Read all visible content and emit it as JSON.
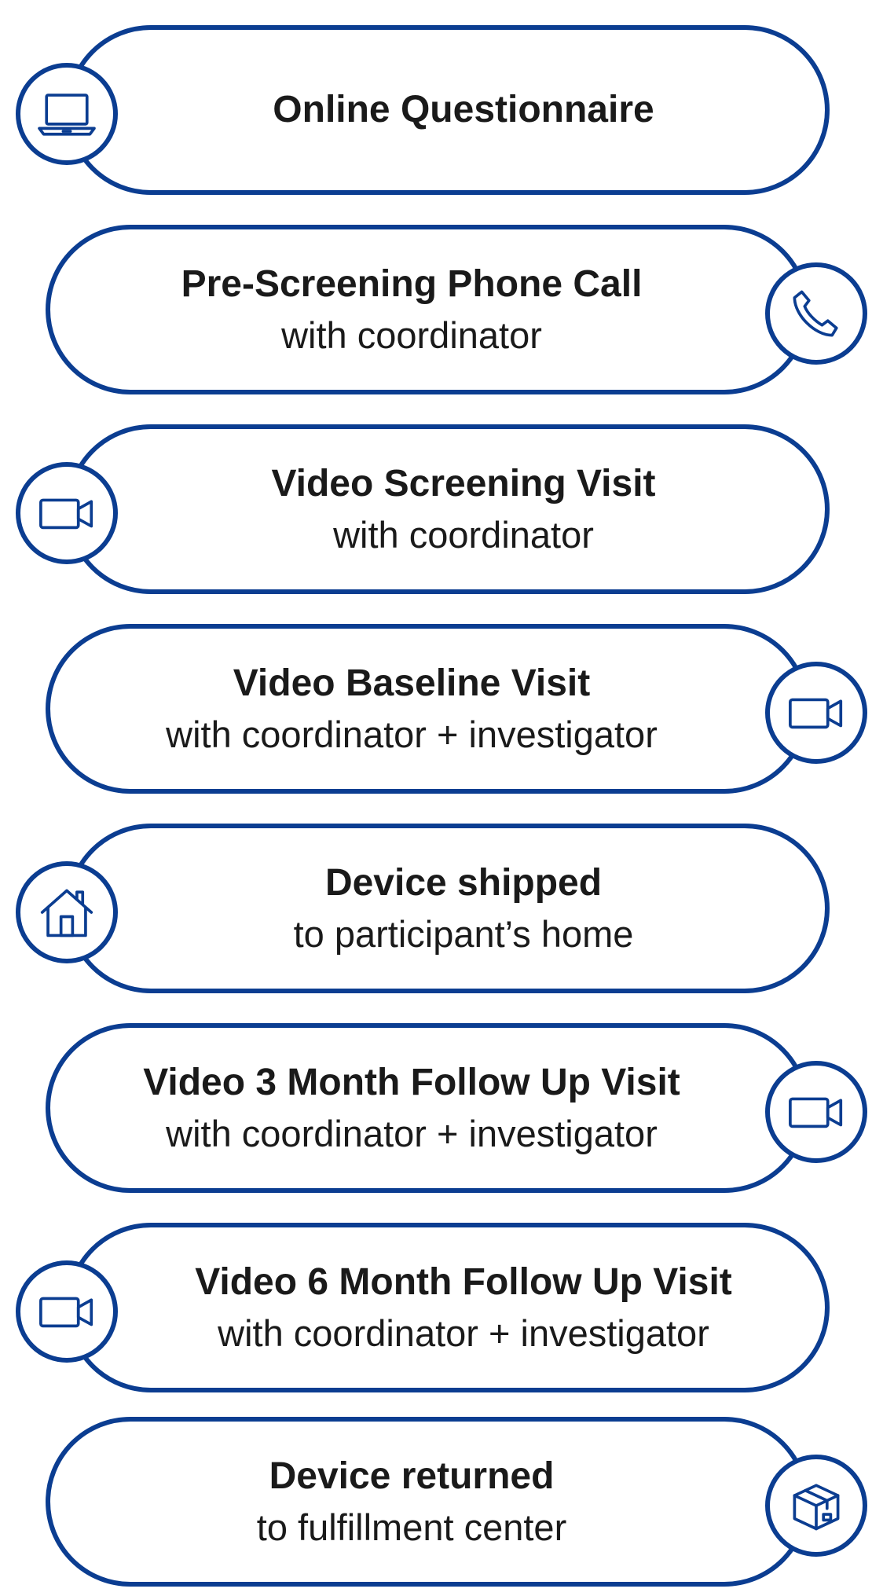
{
  "steps": [
    {
      "title": "Online Questionnaire",
      "subtitle": "",
      "icon": "laptop-icon",
      "side": "left"
    },
    {
      "title": "Pre-Screening Phone Call",
      "subtitle": "with coordinator",
      "icon": "phone-icon",
      "side": "right"
    },
    {
      "title": "Video Screening Visit",
      "subtitle": "with coordinator",
      "icon": "video-camera-icon",
      "side": "left"
    },
    {
      "title": "Video Baseline Visit",
      "subtitle": "with coordinator + investigator",
      "icon": "video-camera-icon",
      "side": "right"
    },
    {
      "title": "Device shipped",
      "subtitle": "to participant’s home",
      "icon": "house-icon",
      "side": "left"
    },
    {
      "title": "Video 3 Month Follow Up Visit",
      "subtitle": "with coordinator + investigator",
      "icon": "video-camera-icon",
      "side": "right"
    },
    {
      "title": "Video 6 Month Follow Up Visit",
      "subtitle": "with coordinator + investigator",
      "icon": "video-camera-icon",
      "side": "left"
    },
    {
      "title": "Device returned",
      "subtitle": "to fulfillment center",
      "icon": "package-icon",
      "side": "right"
    }
  ],
  "colors": {
    "outline": "#0b3d91",
    "text": "#1a1a1a",
    "background": "#ffffff"
  }
}
